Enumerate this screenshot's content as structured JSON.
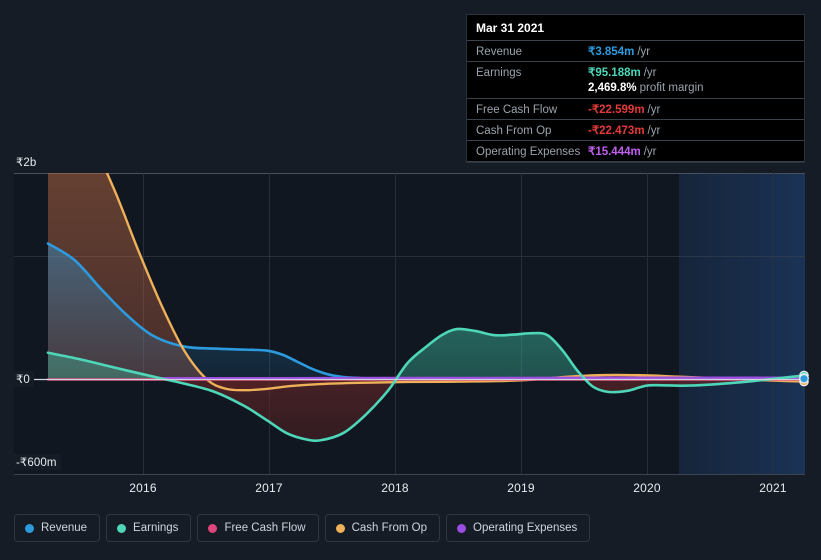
{
  "chart_data": {
    "type": "line",
    "title": "",
    "xlabel": "",
    "ylabel": "",
    "currency": "₹",
    "grid": true,
    "legend_position": "bottom",
    "x_ticks": [
      "2016",
      "2017",
      "2018",
      "2019",
      "2020",
      "2021"
    ],
    "y_ticks": [
      "₹2b",
      "₹0",
      "-₹600m"
    ],
    "ylim": [
      -600000000,
      2000000000
    ],
    "xlim": [
      "2015-06",
      "2021-06"
    ],
    "forecast_region_start": "2020-04",
    "series": [
      {
        "name": "Revenue",
        "color": "#2c9bde",
        "points": [
          [
            0.0,
            0.66
          ],
          [
            0.07,
            0.58
          ],
          [
            0.14,
            0.44
          ],
          [
            0.21,
            0.31
          ],
          [
            0.28,
            0.21
          ],
          [
            0.36,
            0.16
          ],
          [
            0.44,
            0.15
          ],
          [
            0.52,
            0.145
          ],
          [
            0.58,
            0.14
          ],
          [
            0.62,
            0.12
          ],
          [
            0.66,
            0.085
          ],
          [
            0.7,
            0.05
          ],
          [
            0.74,
            0.025
          ],
          [
            0.78,
            0.012
          ],
          [
            0.84,
            0.006
          ],
          [
            0.9,
            0.004
          ],
          [
            1.0,
            0.004
          ]
        ]
      },
      {
        "name": "Earnings",
        "color": "#4dd6b8",
        "points": [
          [
            0.0,
            0.13
          ],
          [
            0.08,
            0.1
          ],
          [
            0.16,
            0.065
          ],
          [
            0.24,
            0.03
          ],
          [
            0.3,
            0.005
          ],
          [
            0.36,
            -0.02
          ],
          [
            0.44,
            -0.06
          ],
          [
            0.52,
            -0.13
          ],
          [
            0.58,
            -0.2
          ],
          [
            0.63,
            -0.26
          ],
          [
            0.68,
            -0.29
          ],
          [
            0.72,
            -0.295
          ],
          [
            0.78,
            -0.26
          ],
          [
            0.84,
            -0.17
          ],
          [
            0.9,
            -0.05
          ],
          [
            0.95,
            0.08
          ],
          [
            1.0,
            0.16
          ],
          [
            1.04,
            0.215
          ],
          [
            1.08,
            0.245
          ],
          [
            1.13,
            0.235
          ],
          [
            1.18,
            0.215
          ],
          [
            1.23,
            0.218
          ],
          [
            1.28,
            0.225
          ],
          [
            1.32,
            0.215
          ],
          [
            1.36,
            0.14
          ],
          [
            1.4,
            0.04
          ],
          [
            1.44,
            -0.035
          ],
          [
            1.48,
            -0.06
          ],
          [
            1.53,
            -0.055
          ],
          [
            1.58,
            -0.03
          ],
          [
            1.62,
            -0.028
          ],
          [
            1.68,
            -0.03
          ],
          [
            1.74,
            -0.026
          ],
          [
            1.8,
            -0.018
          ],
          [
            1.86,
            -0.008
          ],
          [
            1.93,
            0.006
          ],
          [
            2.0,
            0.02
          ]
        ]
      },
      {
        "name": "Free Cash Flow",
        "color": "#e0457b",
        "points": [
          [
            0.0,
            0.0
          ],
          [
            0.5,
            0.0
          ],
          [
            1.0,
            0.0
          ],
          [
            1.5,
            0.0
          ],
          [
            2.0,
            0.0
          ]
        ]
      },
      {
        "name": "Cash From Op",
        "color": "#eeb058",
        "points": [
          [
            0.0,
            1.6
          ],
          [
            0.06,
            1.4
          ],
          [
            0.12,
            1.15
          ],
          [
            0.18,
            0.9
          ],
          [
            0.24,
            0.62
          ],
          [
            0.3,
            0.36
          ],
          [
            0.36,
            0.14
          ],
          [
            0.42,
            0.0
          ],
          [
            0.47,
            -0.045
          ],
          [
            0.52,
            -0.052
          ],
          [
            0.58,
            -0.045
          ],
          [
            0.64,
            -0.032
          ],
          [
            0.72,
            -0.022
          ],
          [
            0.82,
            -0.016
          ],
          [
            0.95,
            -0.012
          ],
          [
            1.1,
            -0.01
          ],
          [
            1.25,
            -0.004
          ],
          [
            1.36,
            0.012
          ],
          [
            1.44,
            0.02
          ],
          [
            1.5,
            0.022
          ],
          [
            1.58,
            0.02
          ],
          [
            1.66,
            0.014
          ],
          [
            1.74,
            0.008
          ],
          [
            1.82,
            0.002
          ],
          [
            1.9,
            -0.004
          ],
          [
            1.96,
            -0.008
          ],
          [
            2.0,
            -0.01
          ]
        ]
      },
      {
        "name": "Operating Expenses",
        "color": "#9b4de0",
        "points": [
          [
            0.3,
            0.005
          ],
          [
            0.6,
            0.005
          ],
          [
            0.9,
            0.006
          ],
          [
            1.2,
            0.006
          ],
          [
            1.5,
            0.007
          ],
          [
            1.8,
            0.007
          ],
          [
            2.0,
            0.007
          ]
        ]
      }
    ]
  },
  "tooltip": {
    "date": "Mar 31 2021",
    "rows": [
      {
        "label": "Revenue",
        "value": "₹3.854m",
        "unit": "/yr",
        "color": "#2c9bde"
      },
      {
        "label": "Earnings",
        "value": "₹95.188m",
        "unit": "/yr",
        "color": "#4dd6b8"
      },
      {
        "label": "Free Cash Flow",
        "value": "-₹22.599m",
        "unit": "/yr",
        "color": "#e33a3a"
      },
      {
        "label": "Cash From Op",
        "value": "-₹22.473m",
        "unit": "/yr",
        "color": "#e33a3a"
      },
      {
        "label": "Operating Expenses",
        "value": "₹15.444m",
        "unit": "/yr",
        "color": "#c060f0"
      }
    ],
    "profit_margin_value": "2,469.8%",
    "profit_margin_label": "profit margin"
  },
  "axis": {
    "y_top": "₹2b",
    "y_zero": "₹0",
    "y_bottom": "-₹600m",
    "x": [
      "2016",
      "2017",
      "2018",
      "2019",
      "2020",
      "2021"
    ]
  },
  "legend": [
    {
      "label": "Revenue",
      "color": "#2c9bde"
    },
    {
      "label": "Earnings",
      "color": "#4dd6b8"
    },
    {
      "label": "Free Cash Flow",
      "color": "#e0457b"
    },
    {
      "label": "Cash From Op",
      "color": "#eeb058"
    },
    {
      "label": "Operating Expenses",
      "color": "#9b4de0"
    }
  ]
}
